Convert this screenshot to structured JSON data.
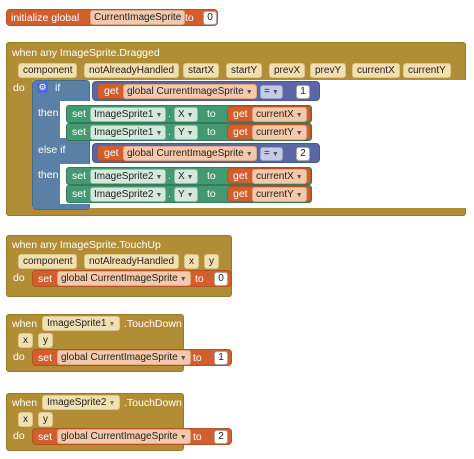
{
  "init": {
    "prefix": "initialize global",
    "name": "CurrentImageSprite",
    "to": "to",
    "value": "0"
  },
  "drag": {
    "header": "when any ImageSprite.Dragged",
    "params": [
      "component",
      "notAlreadyHandled",
      "startX",
      "startY",
      "prevX",
      "prevY",
      "currentX",
      "currentY"
    ],
    "do": "do",
    "if": "if",
    "get": "get",
    "getvar": "global CurrentImageSprite",
    "eq": "=",
    "one": "1",
    "two": "2",
    "then": "then",
    "elseif": "else if",
    "set": "set",
    "to": "to",
    "sprite1": "ImageSprite1",
    "sprite2": "ImageSprite2",
    "X": "X",
    "Y": "Y",
    "curX": "currentX",
    "curY": "currentY"
  },
  "touchup": {
    "header": "when any ImageSprite.TouchUp",
    "params": [
      "component",
      "notAlreadyHandled",
      "x",
      "y"
    ],
    "do": "do",
    "set": "set",
    "var": "global CurrentImageSprite",
    "to": "to",
    "value": "0"
  },
  "td1": {
    "when": "when",
    "sprite": "ImageSprite1",
    "event": ".TouchDown",
    "params": [
      "x",
      "y"
    ],
    "do": "do",
    "set": "set",
    "var": "global CurrentImageSprite",
    "to": "to",
    "value": "1"
  },
  "td2": {
    "when": "when",
    "sprite": "ImageSprite2",
    "event": ".TouchDown",
    "params": [
      "x",
      "y"
    ],
    "do": "do",
    "set": "set",
    "var": "global CurrentImageSprite",
    "to": "to",
    "value": "2"
  },
  "colors": {
    "orange": "#d05f2d",
    "gold": "#b18e35",
    "green": "#439970",
    "blue": "#5b80a5"
  }
}
